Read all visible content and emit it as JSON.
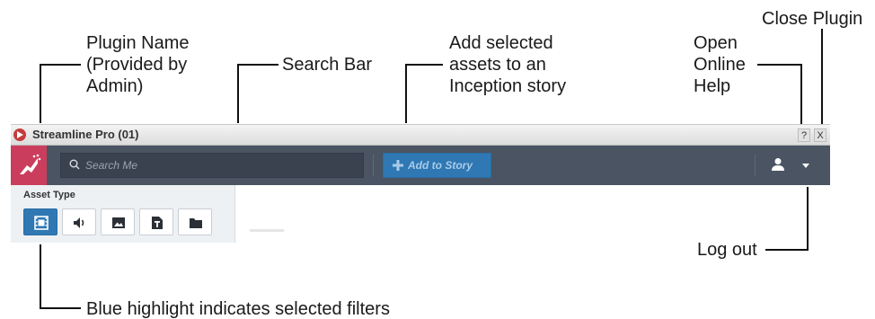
{
  "annotations": {
    "plugin_name_1": "Plugin Name",
    "plugin_name_2": "(Provided by",
    "plugin_name_3": "Admin)",
    "search_bar": "Search Bar",
    "add_1": "Add selected",
    "add_2": "assets to an",
    "add_3": "Inception story",
    "help_1": "Open",
    "help_2": "Online",
    "help_3": "Help",
    "close_plugin": "Close Plugin",
    "log_out": "Log out",
    "blue_highlight": "Blue highlight indicates selected filters"
  },
  "window": {
    "title": "Streamline Pro (01)",
    "help_button": "?",
    "close_button": "X"
  },
  "toolbar": {
    "search_placeholder": "Search Me",
    "add_label": "Add to Story",
    "icons": [
      "brand-logo-icon",
      "search-icon",
      "plus-icon",
      "user-icon",
      "caret-down-icon"
    ]
  },
  "panel": {
    "title": "Asset Type",
    "filters": [
      {
        "icon": "video-icon",
        "selected": true
      },
      {
        "icon": "audio-icon",
        "selected": false
      },
      {
        "icon": "image-icon",
        "selected": false
      },
      {
        "icon": "text-document-icon",
        "selected": false
      },
      {
        "icon": "folder-icon",
        "selected": false
      }
    ]
  },
  "colors": {
    "toolbar": "#4a5463",
    "brand": "#cb3d5c",
    "accent": "#2f78b3",
    "panel": "#eef1f4"
  }
}
